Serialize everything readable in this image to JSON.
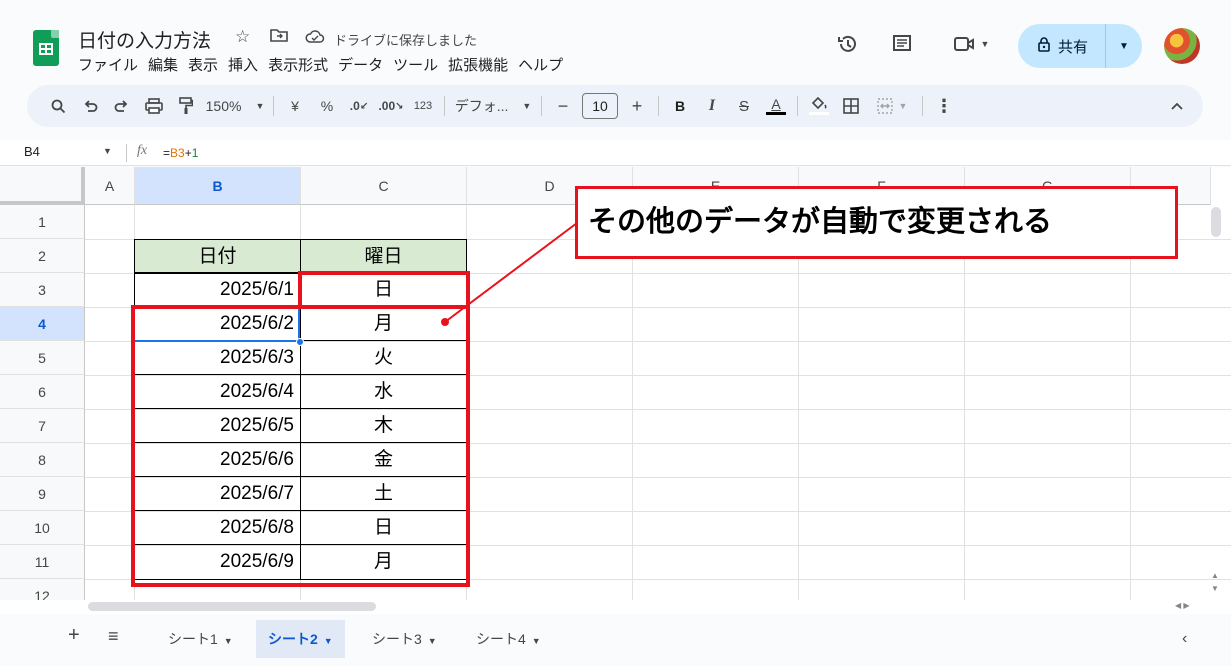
{
  "header": {
    "doc_title": "日付の入力方法",
    "save_status": "ドライブに保存しました",
    "menu": [
      "ファイル",
      "編集",
      "表示",
      "挿入",
      "表示形式",
      "データ",
      "ツール",
      "拡張機能",
      "ヘルプ"
    ],
    "share_label": "共有"
  },
  "toolbar": {
    "zoom": "150%",
    "currency": "¥",
    "percent": "%",
    "decrease_decimal": ".0",
    "increase_decimal": ".00",
    "number_format": "123",
    "font": "デフォ...",
    "font_size": "10",
    "minus": "−",
    "plus": "+",
    "bold": "B",
    "italic": "I",
    "strike": "S",
    "text_color": "A"
  },
  "formula_bar": {
    "cell_ref": "B4",
    "fx": "fx",
    "formula_eq": "=",
    "formula_ref": "B3",
    "formula_op": "+",
    "formula_num": "1"
  },
  "grid": {
    "columns": [
      "A",
      "B",
      "C",
      "D",
      "E",
      "F",
      "G"
    ],
    "rows": [
      "1",
      "2",
      "3",
      "4",
      "5",
      "6",
      "7",
      "8",
      "9",
      "10",
      "11",
      "12"
    ],
    "selected_column": "B",
    "selected_row": "4",
    "table_headers": [
      "日付",
      "曜日"
    ],
    "table_rows": [
      {
        "date": "2025/6/1",
        "day": "日"
      },
      {
        "date": "2025/6/2",
        "day": "月"
      },
      {
        "date": "2025/6/3",
        "day": "火"
      },
      {
        "date": "2025/6/4",
        "day": "水"
      },
      {
        "date": "2025/6/5",
        "day": "木"
      },
      {
        "date": "2025/6/6",
        "day": "金"
      },
      {
        "date": "2025/6/7",
        "day": "土"
      },
      {
        "date": "2025/6/8",
        "day": "日"
      },
      {
        "date": "2025/6/9",
        "day": "月"
      }
    ]
  },
  "annotation": {
    "text": "その他のデータが自動で変更される",
    "color": "#e8121e"
  },
  "sheet_tabs": [
    {
      "label": "シート1",
      "active": false
    },
    {
      "label": "シート2",
      "active": true
    },
    {
      "label": "シート3",
      "active": false
    },
    {
      "label": "シート4",
      "active": false
    }
  ],
  "colors": {
    "header_fill": "#d9ead3",
    "selection": "#1a73e8",
    "share_button": "#c2e7ff",
    "sheets_green": "#0f9d58"
  }
}
